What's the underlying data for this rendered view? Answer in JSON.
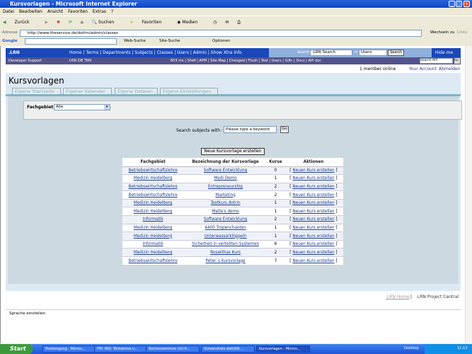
{
  "window": {
    "title": "Kursvorlagen - Microsoft Internet Explorer"
  },
  "menu": [
    "Datei",
    "Bearbeiten",
    "Ansicht",
    "Favoriten",
    "Extras",
    "?"
  ],
  "toolbar": [
    "Zurück",
    "Suchen",
    "Favoriten",
    "Medien"
  ],
  "address": {
    "label": "Adresse",
    "url": "http://www.theservice.de/dotlrn/admin/classes",
    "go": "Wechseln zu",
    "links": "Links"
  },
  "google": {
    "logo": "Google",
    "items": [
      "Web-Suche",
      "Site-Suche",
      "Optionen"
    ]
  },
  "dotlrn": {
    "logo": ".LRN",
    "nav": "Home | Terms | Departments | Subjects | Classes | Users | Admin | Show Xtra Info",
    "search_label": "Search:",
    "search_value": ".LRN Search",
    "in_label": "in",
    "scope": "Users",
    "search_button": "Search",
    "hide": "Hide me",
    "dev_support": "Developer Support",
    "usr": "USR DB TRN",
    "dev_links": "603 ms | Shell | APM | Site Map | Changed | Flush | Test | Users | I18n | Docs | API doc",
    "api_search": "Search API",
    "api_go": "Go",
    "members": "1 member online",
    "account": "Your Account",
    "logout": "Abmelden"
  },
  "page": {
    "title": "Kursvorlagen",
    "tabs": [
      "Eigene Startseite",
      "Eigener Kalender",
      "Eigene Dateien",
      "Eigene Einstellungen"
    ],
    "filter_label": "Fachgebiet:",
    "filter_value": "Alle",
    "search_label": "Search subjects with :",
    "search_placeholder": "Please type a keyword",
    "go": "Go",
    "new_button": "Neue Kursvorlage erstellen"
  },
  "table": {
    "headers": [
      "Fachgebiet",
      "Bezeichnung der Kursvorlage",
      "Kurse",
      "Aktionen"
    ],
    "action": "Neuen Kurs erstellen",
    "rows": [
      [
        "Betriebswirtschaftslehre",
        "Software Entwicklung",
        "0"
      ],
      [
        "Medizin Heidelberg",
        "Medi Demo",
        "1"
      ],
      [
        "Betriebswirtschaftslehre",
        "Entrepreneurship",
        "2"
      ],
      [
        "Betriebswirtschaftslehre",
        "Marketing",
        "2"
      ],
      [
        "Medizin Heidelberg",
        "Testkurs dotrin",
        "1"
      ],
      [
        "Medizin Heidelberg",
        "Malte's demo",
        "1"
      ],
      [
        "Informatik",
        "Software Entwicklung",
        "2"
      ],
      [
        "Medizin Heidelberg",
        "4400 Tropenchaoten",
        "1"
      ],
      [
        "Medizin Heidelberg",
        "Unterwasserklöppeln",
        "1"
      ],
      [
        "Informatik",
        "Sicherheit in verteilten Systemen",
        "6"
      ],
      [
        "Medizin Heidelberg",
        "Roswithas Kurs",
        "2"
      ],
      [
        "Betriebswirtschaftslehre",
        "Peter´s Kursvorlage",
        "7"
      ]
    ]
  },
  "footer": {
    "home": ".LRN Home",
    "central": ".LRN Project Central",
    "language": "Sprache einstellen"
  },
  "taskbar": {
    "start": "Start",
    "tasks": [
      "Posteingang - Micros...",
      "FW: WG: Teilnahme v...",
      "Rechenzentrum Uni K...",
      "Screenshots dotLRN....",
      "Kursvorlagen - Micros..."
    ],
    "desktop": "Desktop",
    "clock": "11:13"
  }
}
